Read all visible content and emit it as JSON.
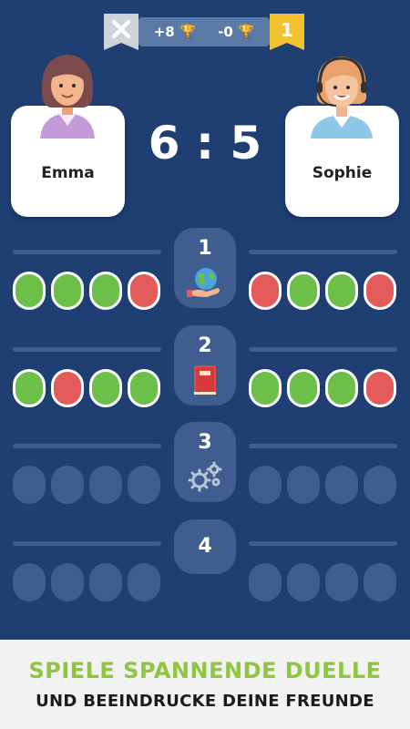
{
  "header": {
    "close_icon": "close-icon",
    "flag_icon": "pennant-flag-icon",
    "trophy_icon": "trophy-icon",
    "left_delta": "+8",
    "right_delta": "-0",
    "flag_number": "1"
  },
  "players": {
    "left": {
      "name": "Emma"
    },
    "right": {
      "name": "Sophie"
    }
  },
  "score": {
    "text": "6 : 5"
  },
  "rounds": [
    {
      "number": "1",
      "icon": "earth-in-hand-icon",
      "left": [
        "correct",
        "correct",
        "correct",
        "wrong"
      ],
      "right": [
        "wrong",
        "correct",
        "correct",
        "wrong"
      ]
    },
    {
      "number": "2",
      "icon": "red-book-icon",
      "left": [
        "correct",
        "wrong",
        "correct",
        "correct"
      ],
      "right": [
        "correct",
        "correct",
        "correct",
        "wrong"
      ]
    },
    {
      "number": "3",
      "icon": "gears-icon",
      "left": [
        "empty",
        "empty",
        "empty",
        "empty"
      ],
      "right": [
        "empty",
        "empty",
        "empty",
        "empty"
      ]
    },
    {
      "number": "4",
      "icon": "",
      "left": [
        "empty",
        "empty",
        "empty",
        "empty"
      ],
      "right": [
        "empty",
        "empty",
        "empty",
        "empty"
      ]
    }
  ],
  "colors": {
    "background": "#1f3f73",
    "correct": "#6cc04a",
    "wrong": "#e35b5b",
    "empty": "#3e5d8e",
    "headline": "#8dc63f",
    "flag": "#f2c230"
  },
  "banner": {
    "line1": "SPIELE SPANNENDE DUELLE",
    "line2": "UND BEEINDRUCKE DEINE FREUNDE"
  }
}
